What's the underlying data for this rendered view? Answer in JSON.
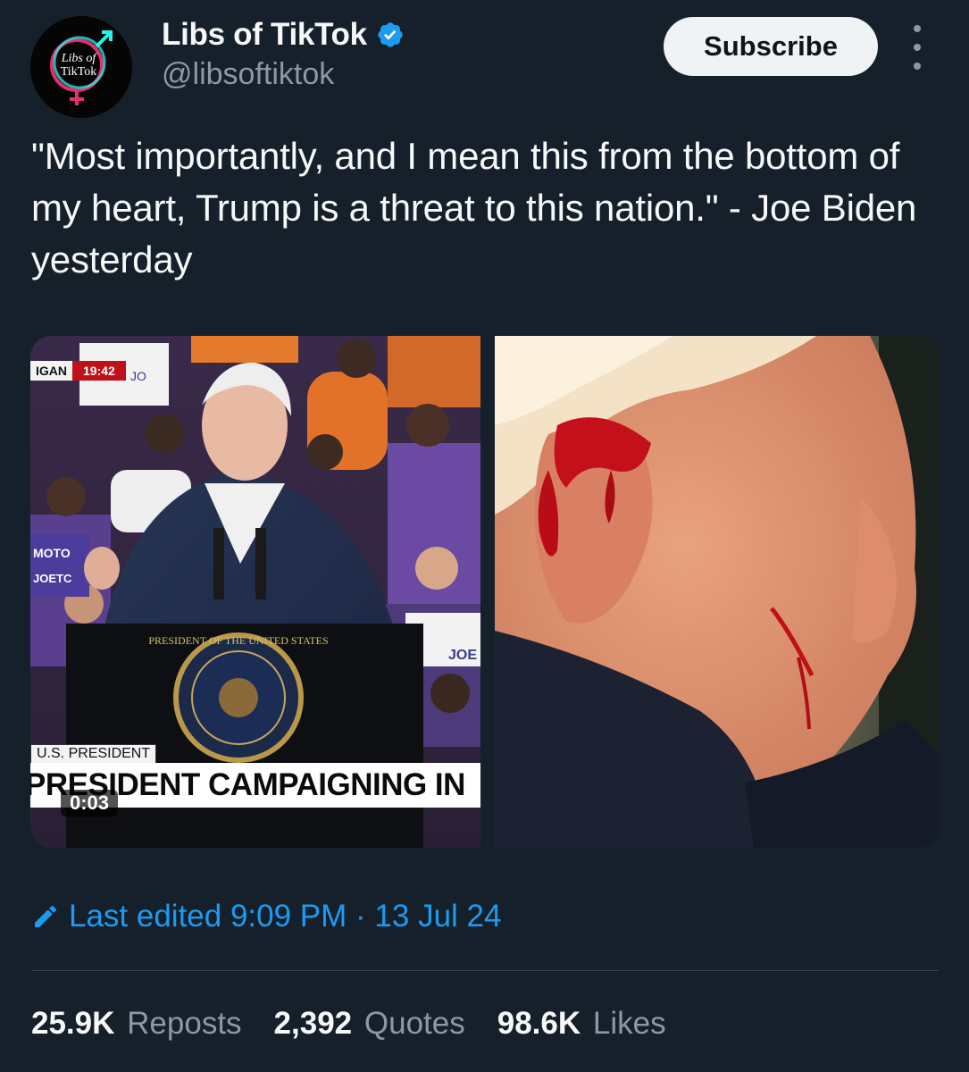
{
  "author": {
    "display_name": "Libs of TikTok",
    "handle": "@libsoftiktok",
    "avatar_text_line1": "Libs of",
    "avatar_text_line2": "TikTok",
    "verified_color": "#1d9bf0"
  },
  "actions": {
    "subscribe_label": "Subscribe"
  },
  "tweet": {
    "text": "\"Most importantly, and I mean this from the bottom of my heart, Trump is a threat to this nation.\" - Joe Biden yesterday"
  },
  "media": {
    "video": {
      "state_bug": "IGAN",
      "clock": "19:42",
      "tag": "U.S. PRESIDENT",
      "headline": "PRESIDENT CAMPAIGNING IN",
      "duration": "0:03",
      "sign_text_1": "JO",
      "sign_text_2": "JOE",
      "sign_text_3": "MOTO",
      "sign_text_4": "JOETC",
      "seal_text": "PRESIDENT OF THE UNITED STATES"
    }
  },
  "edit": {
    "label": "Last edited 9:09 PM · 13 Jul 24"
  },
  "stats": {
    "reposts_count": "25.9K",
    "reposts_label": "Reposts",
    "quotes_count": "2,392",
    "quotes_label": "Quotes",
    "likes_count": "98.6K",
    "likes_label": "Likes"
  },
  "colors": {
    "background": "#15202b",
    "accent": "#1d9bf0",
    "secondary_text": "#8b98a5",
    "primary_text": "#f7f9f9"
  }
}
